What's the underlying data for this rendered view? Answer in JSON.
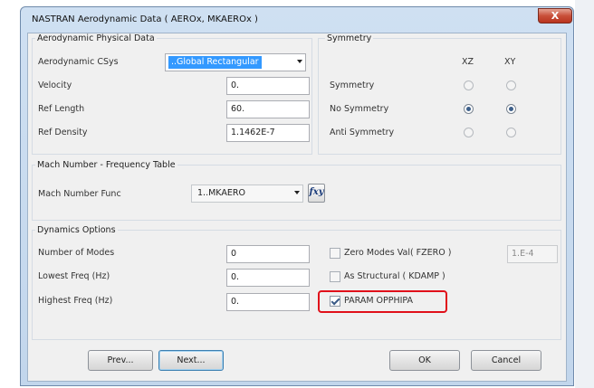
{
  "window": {
    "title": "NASTRAN Aerodynamic Data ( AEROx, MKAEROx )",
    "close_glyph": "X"
  },
  "aero_physical": {
    "group_label": "Aerodynamic Physical Data",
    "csys_label": "Aerodynamic CSys",
    "csys_value": "..Global Rectangular",
    "velocity_label": "Velocity",
    "velocity_value": "0.",
    "ref_length_label": "Ref Length",
    "ref_length_value": "60.",
    "ref_density_label": "Ref Density",
    "ref_density_value": "1.1462E-7"
  },
  "symmetry": {
    "group_label": "Symmetry",
    "col_xz": "XZ",
    "col_xy": "XY",
    "rows": [
      {
        "label": "Symmetry",
        "xz": false,
        "xy": false
      },
      {
        "label": "No Symmetry",
        "xz": true,
        "xy": true
      },
      {
        "label": "Anti Symmetry",
        "xz": false,
        "xy": false
      }
    ]
  },
  "mach": {
    "group_label": "Mach Number - Frequency Table",
    "func_label": "Mach Number Func",
    "func_value": "1..MKAERO",
    "fxy_label": "fxy"
  },
  "dynamics": {
    "group_label": "Dynamics Options",
    "num_modes_label": "Number of Modes",
    "num_modes_value": "0",
    "lowest_freq_label": "Lowest Freq (Hz)",
    "lowest_freq_value": "0.",
    "highest_freq_label": "Highest Freq (Hz)",
    "highest_freq_value": "0.",
    "zero_modes_label": "Zero Modes Val( FZERO )",
    "zero_modes_checked": false,
    "zero_modes_value": "1.E-4",
    "as_structural_label": "As Structural ( KDAMP )",
    "as_structural_checked": false,
    "param_opphipa_label": "PARAM OPPHIPA",
    "param_opphipa_checked": true
  },
  "buttons": {
    "prev": "Prev...",
    "next": "Next...",
    "ok": "OK",
    "cancel": "Cancel"
  },
  "colors": {
    "highlight": "#e0101a",
    "selection": "#3399ff"
  }
}
